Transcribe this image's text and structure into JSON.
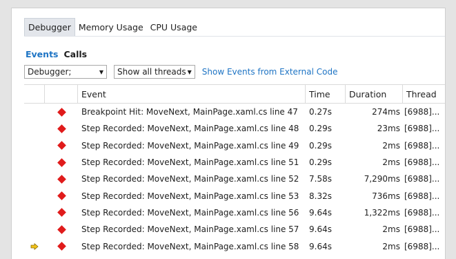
{
  "colors": {
    "accent": "#1e74c4",
    "breakpoint": "#e01b1b",
    "current_arrow": "#f2c21a"
  },
  "tabs": [
    {
      "label": "Debugger",
      "active": true
    },
    {
      "label": "Memory Usage",
      "active": false
    },
    {
      "label": "CPU Usage",
      "active": false
    }
  ],
  "subtabs": [
    {
      "label": "Events",
      "active": true
    },
    {
      "label": "Calls",
      "active": false
    }
  ],
  "toolbar": {
    "category_filter": "Debugger;",
    "thread_filter": "Show all threads",
    "external_code_link": "Show Events from External Code"
  },
  "table": {
    "columns": [
      "Event",
      "Time",
      "Duration",
      "Thread"
    ],
    "rows": [
      {
        "icon": "breakpoint-diamond-icon",
        "event": "Breakpoint Hit: MoveNext, MainPage.xaml.cs line 47",
        "time": "0.27s",
        "duration": "274ms",
        "thread": "[6988]...",
        "current": false
      },
      {
        "icon": "breakpoint-diamond-icon",
        "event": "Step Recorded: MoveNext, MainPage.xaml.cs line 48",
        "time": "0.29s",
        "duration": "23ms",
        "thread": "[6988]...",
        "current": false
      },
      {
        "icon": "breakpoint-diamond-icon",
        "event": "Step Recorded: MoveNext, MainPage.xaml.cs line 49",
        "time": "0.29s",
        "duration": "2ms",
        "thread": "[6988]...",
        "current": false
      },
      {
        "icon": "breakpoint-diamond-icon",
        "event": "Step Recorded: MoveNext, MainPage.xaml.cs line 51",
        "time": "0.29s",
        "duration": "2ms",
        "thread": "[6988]...",
        "current": false
      },
      {
        "icon": "breakpoint-diamond-icon",
        "event": "Step Recorded: MoveNext, MainPage.xaml.cs line 52",
        "time": "7.58s",
        "duration": "7,290ms",
        "thread": "[6988]...",
        "current": false
      },
      {
        "icon": "breakpoint-diamond-icon",
        "event": "Step Recorded: MoveNext, MainPage.xaml.cs line 53",
        "time": "8.32s",
        "duration": "736ms",
        "thread": "[6988]...",
        "current": false
      },
      {
        "icon": "breakpoint-diamond-icon",
        "event": "Step Recorded: MoveNext, MainPage.xaml.cs line 56",
        "time": "9.64s",
        "duration": "1,322ms",
        "thread": "[6988]...",
        "current": false
      },
      {
        "icon": "breakpoint-diamond-icon",
        "event": "Step Recorded: MoveNext, MainPage.xaml.cs line 57",
        "time": "9.64s",
        "duration": "2ms",
        "thread": "[6988]...",
        "current": false
      },
      {
        "icon": "breakpoint-diamond-icon",
        "event": "Step Recorded: MoveNext, MainPage.xaml.cs line 58",
        "time": "9.64s",
        "duration": "2ms",
        "thread": "[6988]...",
        "current": true
      }
    ]
  }
}
